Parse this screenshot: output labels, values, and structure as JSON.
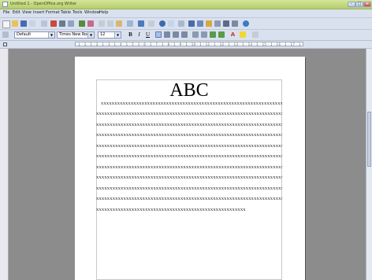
{
  "window": {
    "title": "Untitled 1 - OpenOffice.org Writer"
  },
  "menubar": {
    "items": [
      "File",
      "Edit",
      "View",
      "Insert",
      "Format",
      "Table",
      "Tools",
      "Window",
      "Help"
    ]
  },
  "format_toolbar": {
    "style": "Default",
    "font": "Times New Roman",
    "size": "12",
    "bold": "B",
    "italic": "I",
    "underline": "U"
  },
  "ruler": {
    "scale": "· 1 · 1 · 1 · 2 · 1 · 3 · 1 · 4 · 1 · 5 · 1 · 6 · 1 · 7 · 1 · 8 · 1 · 9 · 1 · 10 · 1 · 11 · 1 · 12 · 1 · 13 · 1 · 14 · 1 · 15 · 1 · 16 · 1 · 17 · 1 · 18 ·"
  },
  "document": {
    "heading": "ABC",
    "lines": [
      "xxxxxxxxxxxxxxxxxxxxxxxxxxxxxxxxxxxxxxxxxxxxxxxxxxxxxxxxxxxxxxxxxxxxx",
      "xxxxxxxxxxxxxxxxxxxxxxxxxxxxxxxxxxxxxxxxxxxxxxxxxxxxxxxxxxxxxxxxxxxxxxx",
      "xxxxxxxxxxxxxxxxxxxxxxxxxxxxxxxxxxxxxxxxxxxxxxxxxxxxxxxxxxxxxxxxxxxxxxx",
      "xxxxxxxxxxxxxxxxxxxxxxxxxxxxxxxxxxxxxxxxxxxxxxxxxxxxxxxxxxxxxxxxxxxxxxx",
      "xxxxxxxxxxxxxxxxxxxxxxxxxxxxxxxxxxxxxxxxxxxxxxxxxxxxxxxxxxxxxxxxxxxxxxx",
      "xxxxxxxxxxxxxxxxxxxxxxxxxxxxxxxxxxxxxxxxxxxxxxxxxxxxxxxxxxxxxxxxxxxxxxx",
      "xxxxxxxxxxxxxxxxxxxxxxxxxxxxxxxxxxxxxxxxxxxxxxxxxxxxxxxxxxxxxxxxxxxxxxx",
      "xxxxxxxxxxxxxxxxxxxxxxxxxxxxxxxxxxxxxxxxxxxxxxxxxxxxxxxxxxxxxxxxxxxxxxx",
      "xxxxxxxxxxxxxxxxxxxxxxxxxxxxxxxxxxxxxxxxxxxxxxxxxxxxxxxxxxxxxxxxxxxxxxx",
      "xxxxxxxxxxxxxxxxxxxxxxxxxxxxxxxxxxxxxxxxxxxxxxxxxxxxxxxxxxxxxxxxxxxxxxx",
      "xxxxxxxxxxxxxxxxxxxxxxxxxxxxxxxxxxxxxxxxxxxxxxxxxxxxxxx"
    ]
  },
  "colors": {
    "titlebar": "#c5da84",
    "chrome": "#d9e1ee",
    "desk": "#8c8c8c",
    "page": "#ffffff"
  }
}
